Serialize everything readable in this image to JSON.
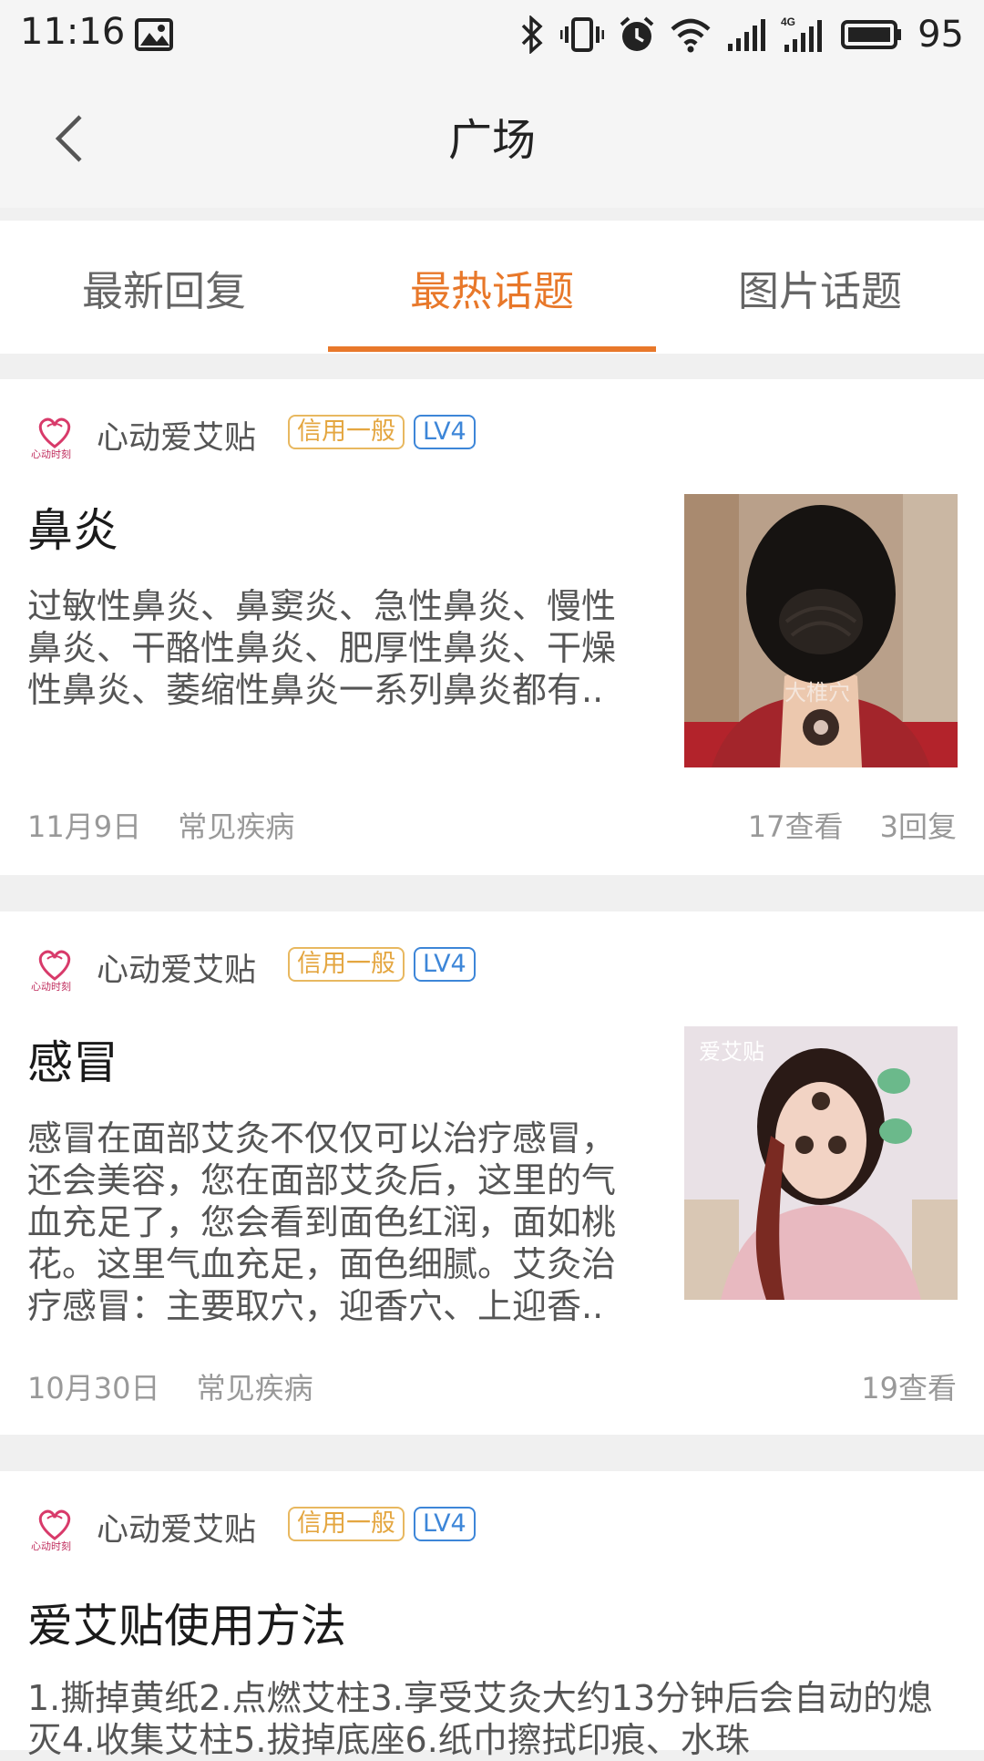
{
  "status_bar": {
    "time": "11:16",
    "battery": "95",
    "icons": [
      "image-icon",
      "bluetooth-icon",
      "vibrate-icon",
      "alarm-icon",
      "wifi-icon",
      "signal-icon",
      "signal-4g-icon",
      "battery-icon"
    ]
  },
  "header": {
    "title": "广场",
    "back_icon": "chevron-left-icon"
  },
  "tabs": [
    {
      "label": "最新回复"
    },
    {
      "label": "最热话题",
      "active": true
    },
    {
      "label": "图片话题"
    }
  ],
  "colors": {
    "accent": "#e8782a",
    "credit_badge": "#e4a640",
    "level_badge": "#3d86d8"
  },
  "posts": [
    {
      "author": "心动爱艾贴",
      "credit": "信用一般",
      "level": "LV4",
      "title": "鼻炎",
      "excerpt": "过敏性鼻炎、鼻窦炎、急性鼻炎、慢性鼻炎、干酪性鼻炎、肥厚性鼻炎、干燥性鼻炎、萎缩性鼻炎一系列鼻炎都有..",
      "image_caption": "大椎穴",
      "date": "11月9日",
      "category": "常见疾病",
      "views": "17查看",
      "replies": "3回复"
    },
    {
      "author": "心动爱艾贴",
      "credit": "信用一般",
      "level": "LV4",
      "title": "感冒",
      "excerpt": "感冒在面部艾灸不仅仅可以治疗感冒，还会美容，您在面部艾灸后，这里的气血充足了，您会看到面色红润，面如桃花。这里气血充足，面色细腻。艾灸治疗感冒：主要取穴，迎香穴、上迎香..",
      "image_caption": "爱艾贴",
      "date": "10月30日",
      "category": "常见疾病",
      "views": "19查看"
    },
    {
      "author": "心动爱艾贴",
      "credit": "信用一般",
      "level": "LV4",
      "title": "爱艾贴使用方法",
      "excerpt": "1.撕掉黄纸2.点燃艾柱3.享受艾灸大约13分钟后会自动的熄灭4.收集艾柱5.拔掉底座6.纸巾擦拭印痕、水珠"
    }
  ]
}
